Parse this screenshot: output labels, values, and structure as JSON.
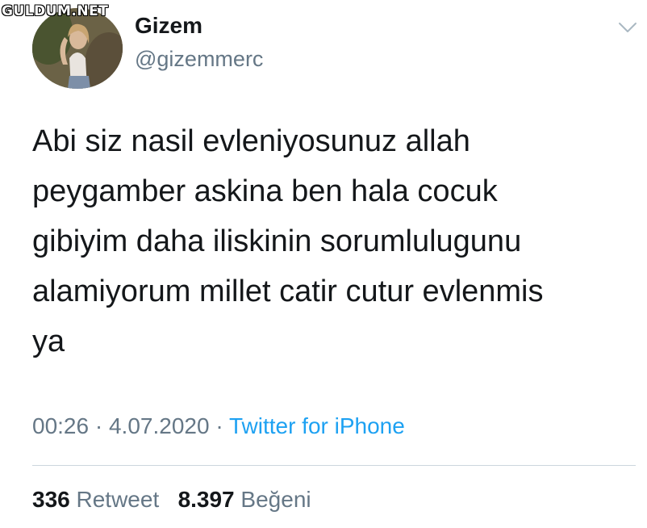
{
  "watermark": "GULDUM.NET",
  "user": {
    "display_name": "Gizem",
    "handle": "@gizemmerc",
    "avatar_icon": "profile-photo"
  },
  "tweet": {
    "lines": [
      "Abi siz nasil evleniyosunuz allah",
      "peygamber askina ben hala cocuk",
      "gibiyim daha iliskinin sorumlulugunu",
      "alamiyorum millet catir cutur evlenmis",
      "ya"
    ]
  },
  "meta": {
    "time": "00:26",
    "separator": "·",
    "date": "4.07.2020",
    "source": "Twitter for iPhone"
  },
  "stats": {
    "retweet_count": "336",
    "retweet_label": "Retweet",
    "like_count": "8.397",
    "like_label": "Beğeni"
  },
  "colors": {
    "text_primary": "#14171a",
    "text_secondary": "#657786",
    "link": "#1da1f2",
    "divider": "#ccd6dd"
  }
}
